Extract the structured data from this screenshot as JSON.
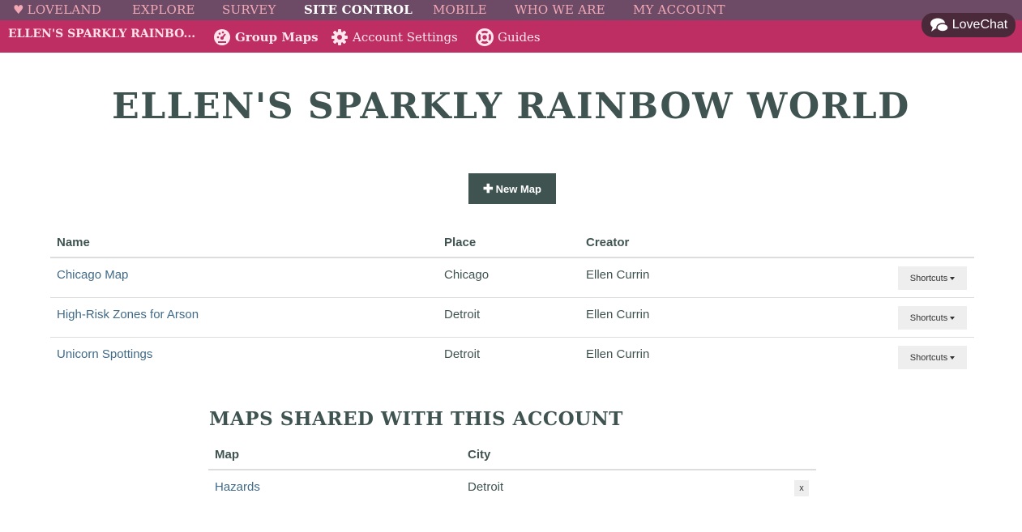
{
  "topnav": {
    "items": [
      {
        "label": "LOVELAND",
        "active": false
      },
      {
        "label": "EXPLORE",
        "active": false
      },
      {
        "label": "SURVEY",
        "active": false
      },
      {
        "label": "SITE CONTROL",
        "active": true
      },
      {
        "label": "MOBILE",
        "active": false
      },
      {
        "label": "WHO WE ARE",
        "active": false
      },
      {
        "label": "MY ACCOUNT",
        "active": false
      }
    ]
  },
  "subnav": {
    "group_name": "ELLEN'S SPARKLY RAINBO...",
    "links": [
      {
        "label": "Group Maps",
        "icon": "dashboard-icon"
      },
      {
        "label": "Account Settings",
        "icon": "gear-icon"
      },
      {
        "label": "Guides",
        "icon": "lifebuoy-icon"
      }
    ]
  },
  "lovechat": {
    "label": "LoveChat",
    "icon": "chat-bubbles-icon"
  },
  "page": {
    "title": "ELLEN'S SPARKLY RAINBOW WORLD",
    "new_map_label": "New Map"
  },
  "maps_table": {
    "headers": [
      "Name",
      "Place",
      "Creator"
    ],
    "rows": [
      {
        "name": "Chicago Map",
        "place": "Chicago",
        "creator": "Ellen Currin",
        "action": "Shortcuts"
      },
      {
        "name": "High-Risk Zones for Arson",
        "place": "Detroit",
        "creator": "Ellen Currin",
        "action": "Shortcuts"
      },
      {
        "name": "Unicorn Spottings",
        "place": "Detroit",
        "creator": "Ellen Currin",
        "action": "Shortcuts"
      }
    ]
  },
  "shared": {
    "title": "MAPS SHARED WITH THIS ACCOUNT",
    "headers": [
      "Map",
      "City"
    ],
    "rows": [
      {
        "map": "Hazards",
        "city": "Detroit",
        "remove": "x"
      }
    ]
  },
  "colors": {
    "topnav_bg": "#6d4a66",
    "subnav_bg": "#be2e62",
    "text_dark": "#3f5350",
    "link": "#416a87",
    "button_bg": "#3f5350"
  }
}
